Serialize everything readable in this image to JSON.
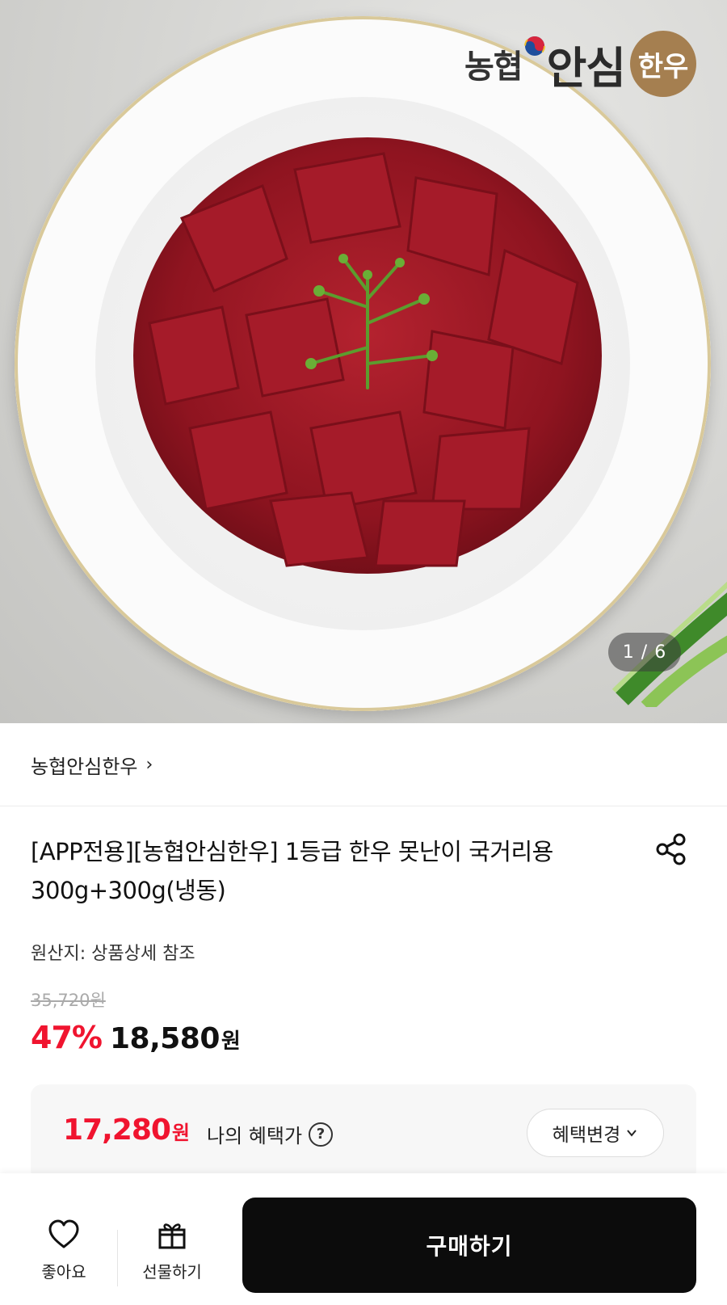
{
  "hero": {
    "brand_logo": {
      "text_part1": "농협",
      "text_part2": "안심",
      "seal_text": "한우"
    },
    "page_indicator": "1 / 6"
  },
  "store": {
    "name": "농협안심한우",
    "chevron": "›"
  },
  "product": {
    "title": "[APP전용][농협안심한우] 1등급 한우 못난이 국거리용 300g+300g(냉동)",
    "origin": "원산지: 상품상세 참조",
    "original_price": "35,720원",
    "discount": "47%",
    "sale_price": "18,580",
    "sale_currency": "원"
  },
  "benefit": {
    "price": "17,280",
    "currency": "원",
    "label": "나의 혜택가",
    "help": "?",
    "change_button": "혜택변경"
  },
  "bottom_bar": {
    "like_label": "좋아요",
    "gift_label": "선물하기",
    "buy_label": "구매하기"
  },
  "colors": {
    "accent_red": "#f0142f",
    "buy_button": "#0c0c0c",
    "logo_seal": "#a57f50"
  },
  "icons": [
    "share-icon",
    "heart-icon",
    "gift-icon",
    "question-icon",
    "chevron-down-icon",
    "chevron-right-icon"
  ]
}
